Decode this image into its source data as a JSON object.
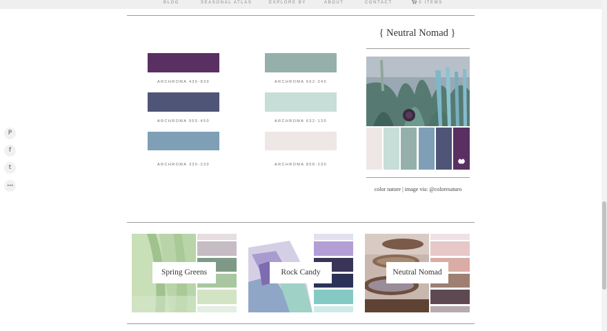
{
  "nav": {
    "items": [
      "BLOG",
      "SEASONAL ATLAS",
      "EXPLORE BY",
      "ABOUT",
      "CONTACT"
    ],
    "cart_icon": "cart-icon",
    "cart_label": "0 ITEMS"
  },
  "share": {
    "icons": [
      "pinterest-icon",
      "facebook-icon",
      "twitter-icon",
      "more-icon"
    ],
    "glyphs": [
      "P",
      "f",
      "t",
      "•••"
    ]
  },
  "swatches": [
    {
      "label": "ARCHROMA 436-830",
      "color": "#5a2f62"
    },
    {
      "label": "ARCHROMA 955-450",
      "color": "#4f5577"
    },
    {
      "label": "ARCHROMA 330-230",
      "color": "#7f9fb6"
    },
    {
      "label": "ARCHROMA 662-340",
      "color": "#95b0aa"
    },
    {
      "label": "ARCHROMA 632-130",
      "color": "#c7ddd8"
    },
    {
      "label": "ARCHROMA 858-230",
      "color": "#efe6e6"
    }
  ],
  "palette": {
    "title": "{ Neutral Nomad }",
    "strip_colors": [
      "#efe6e6",
      "#c7ddd8",
      "#95b0aa",
      "#7f9fb6",
      "#4f5577",
      "#5a2f62"
    ],
    "credit": "color nature | image via: @coloresaturo"
  },
  "related": [
    {
      "title": "Spring Greens",
      "swatches": [
        "#e6dde0",
        "#c6bcc4",
        "#7e9a86",
        "#a8c7a0",
        "#d2e4c4",
        "#e4eee2"
      ]
    },
    {
      "title": "Rock Candy",
      "swatches": [
        "#e4e1ee",
        "#b49ed6",
        "#3a3459",
        "#2c3257",
        "#84c9c4",
        "#cfeae8"
      ]
    },
    {
      "title": "Neutral Nomad",
      "swatches": [
        "#efe2e4",
        "#e6c8c9",
        "#d9aca6",
        "#9e7f72",
        "#5e4953",
        "#b7a9ad"
      ]
    }
  ]
}
